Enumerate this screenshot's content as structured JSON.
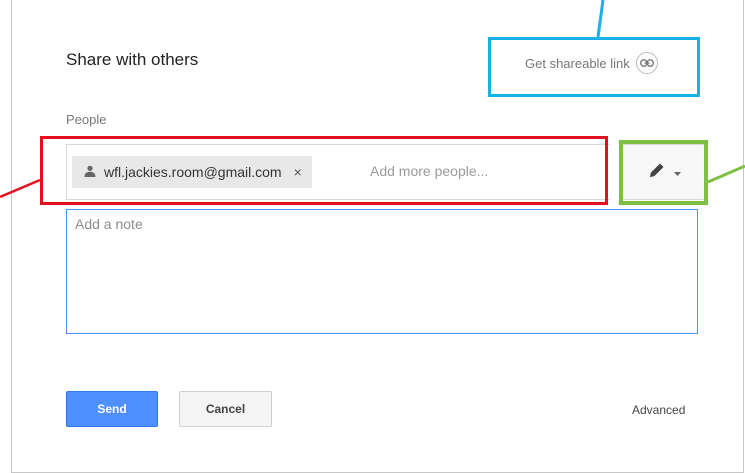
{
  "dialog": {
    "title": "Share with others",
    "share_link_label": "Get shareable link",
    "people_label": "People",
    "chip_email": "wfl.jackies.room@gmail.com",
    "chip_remove": "×",
    "add_more_placeholder": "Add more people...",
    "note_placeholder": "Add a note",
    "send_label": "Send",
    "cancel_label": "Cancel",
    "advanced_label": "Advanced"
  },
  "icons": {
    "link": "link-icon",
    "person": "person-icon",
    "pencil": "pencil-icon",
    "dropdown": "chevron-down-icon"
  },
  "colors": {
    "primary": "#4d90fe",
    "annotation_blue": "#1ab0e8",
    "annotation_red": "#e4101f",
    "annotation_green": "#7cc142"
  }
}
